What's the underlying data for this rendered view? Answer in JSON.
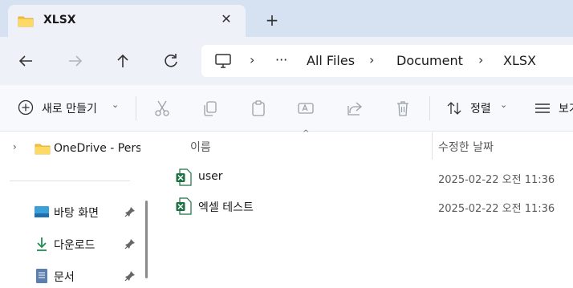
{
  "tab": {
    "title": "XLSX",
    "close_icon": "close-icon",
    "new_tab_icon": "plus-icon"
  },
  "nav": {
    "back_icon": "arrow-left-icon",
    "forward_icon": "arrow-right-icon",
    "up_icon": "arrow-up-icon",
    "refresh_icon": "refresh-icon",
    "breadcrumbs": [
      "All Files",
      "Document",
      "XLSX"
    ],
    "more": "···"
  },
  "toolbar": {
    "new_label": "새로 만들기",
    "sort_label": "정렬",
    "view_label": "보기"
  },
  "sidebar": {
    "items": [
      {
        "label": "OneDrive - Pers",
        "icon": "folder-icon"
      },
      {
        "label": "바탕 화면",
        "icon": "desktop-icon"
      },
      {
        "label": "다운로드",
        "icon": "download-icon"
      },
      {
        "label": "문서",
        "icon": "document-icon"
      }
    ]
  },
  "columns": {
    "name": "이름",
    "modified": "수정한 날짜"
  },
  "files": [
    {
      "name": "user",
      "modified": "2025-02-22 오전 11:36",
      "icon": "excel-icon"
    },
    {
      "name": "엑셀 테스트",
      "modified": "2025-02-22 오전 11:36",
      "icon": "excel-icon"
    }
  ],
  "colors": {
    "titlebar": "#d6e2f1",
    "nav": "#eef2f8",
    "excel": "#1d7044",
    "folder": "#f5c542"
  }
}
